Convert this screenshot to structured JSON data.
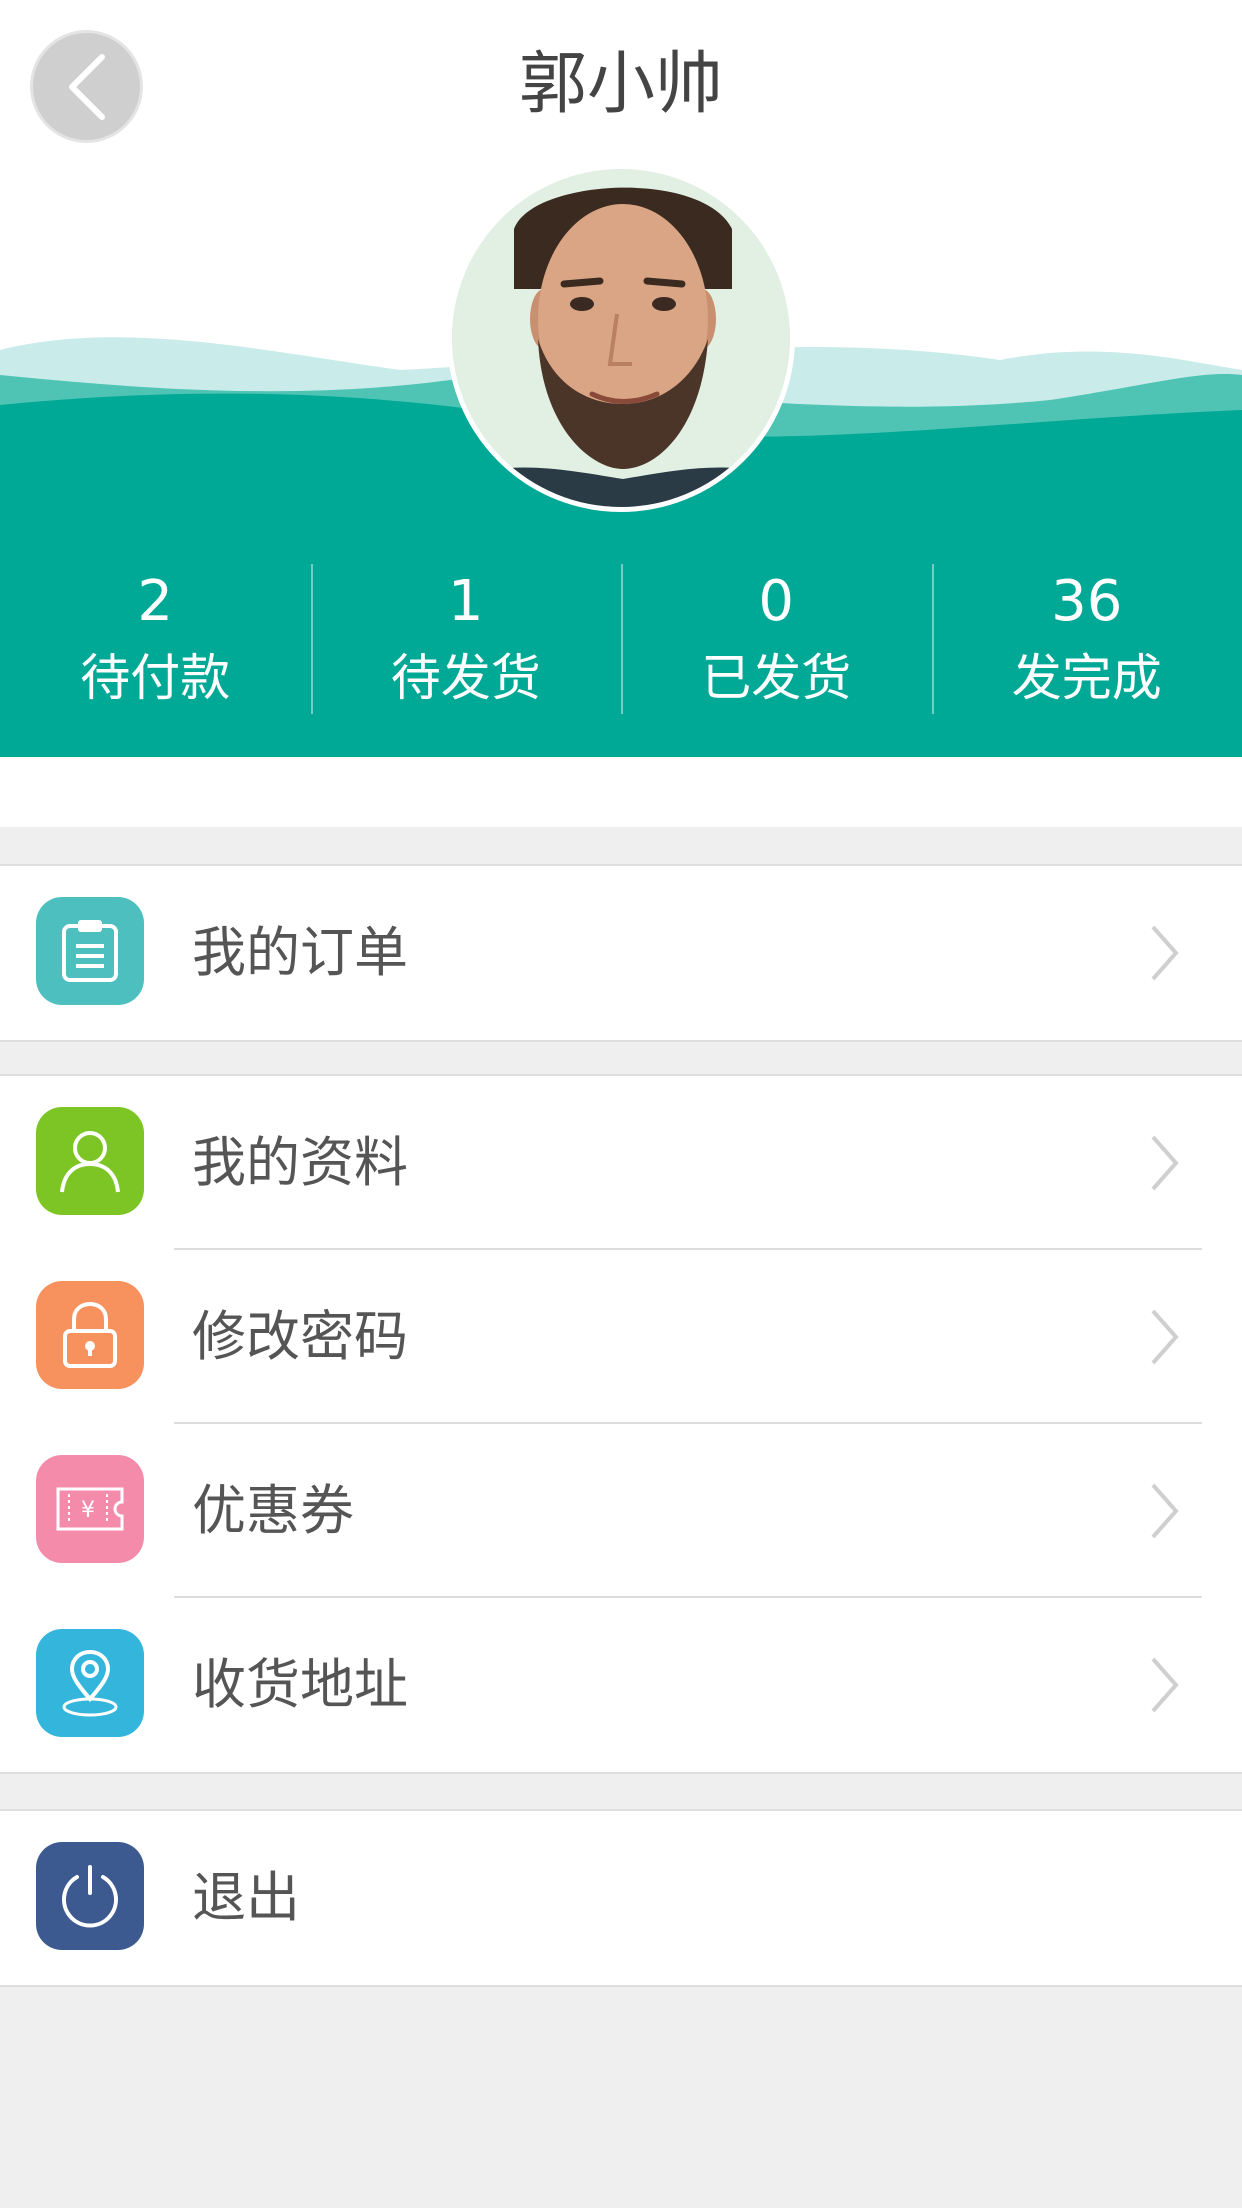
{
  "header": {
    "title": "郭小帅",
    "colors": {
      "teal": "#00a896",
      "teal_mid": "#4fc4b4",
      "teal_light": "#c9ecea"
    }
  },
  "stats": [
    {
      "count": "2",
      "label": "待付款"
    },
    {
      "count": "1",
      "label": "待发货"
    },
    {
      "count": "0",
      "label": "已发货"
    },
    {
      "count": "36",
      "label": "发完成"
    }
  ],
  "menu": {
    "orders": {
      "label": "我的订单",
      "icon": "clipboard-icon",
      "color": "#4ebfbf"
    },
    "profile": {
      "label": "我的资料",
      "icon": "user-icon",
      "color": "#7cc524"
    },
    "password": {
      "label": "修改密码",
      "icon": "lock-icon",
      "color": "#f7925f"
    },
    "coupon": {
      "label": "优惠券",
      "icon": "coupon-icon",
      "color": "#f58bab"
    },
    "address": {
      "label": "收货地址",
      "icon": "location-pin-icon",
      "color": "#33b5dc"
    },
    "logout": {
      "label": "退出",
      "icon": "power-icon",
      "color": "#3c5a8f"
    }
  }
}
